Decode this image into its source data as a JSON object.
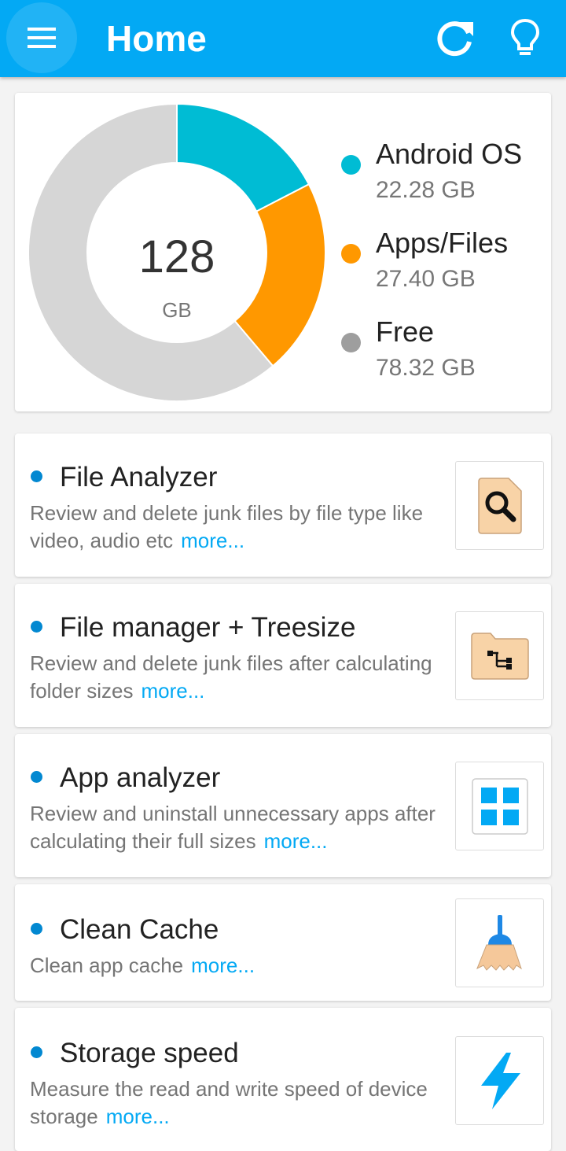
{
  "appbar": {
    "title": "Home",
    "color": "#03a9f4",
    "icons": [
      "menu-icon",
      "refresh-icon",
      "lightbulb-icon"
    ]
  },
  "storage": {
    "total": "128",
    "total_unit": "GB",
    "segments": [
      {
        "label": "Android OS",
        "value": "22.28 GB",
        "gb": 22.28,
        "color": "#00bcd4"
      },
      {
        "label": "Apps/Files",
        "value": "27.40 GB",
        "gb": 27.4,
        "color": "#ff9800"
      },
      {
        "label": "Free",
        "value": "78.32 GB",
        "gb": 78.32,
        "color": "#d6d6d6"
      }
    ],
    "legend_dot_colors": [
      "#00bcd4",
      "#ff9800",
      "#9e9e9e"
    ]
  },
  "features": [
    {
      "title": "File Analyzer",
      "desc": "Review and delete junk files by file type like video, audio etc",
      "more": "more...",
      "icon": "file-search-icon"
    },
    {
      "title": "File manager + Treesize",
      "desc": "Review and delete junk files after calculating folder sizes",
      "more": "more...",
      "icon": "folder-tree-icon"
    },
    {
      "title": "App analyzer",
      "desc": "Review and uninstall unnecessary apps after calculating their full sizes",
      "more": "more...",
      "icon": "app-grid-icon"
    },
    {
      "title": "Clean Cache",
      "desc": "Clean app cache",
      "more": "more...",
      "icon": "broom-icon"
    },
    {
      "title": "Storage speed",
      "desc": "Measure the read and write speed of device storage",
      "more": "more...",
      "icon": "lightning-icon"
    }
  ]
}
